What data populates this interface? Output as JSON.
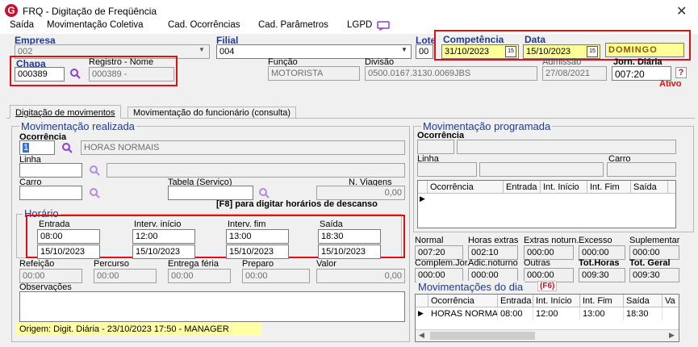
{
  "window": {
    "title": "FRQ - Digitação de Freqüência",
    "app_letter": "G"
  },
  "menu": [
    "Saída",
    "Movimentação Coletiva",
    "Cad. Ocorrências",
    "Cad. Parâmetros",
    "LGPD"
  ],
  "header": {
    "empresa_label": "Empresa",
    "empresa_value": "002",
    "filial_label": "Filial",
    "filial_value": "004",
    "lote_label": "Lote",
    "lote_value": "00",
    "competencia_label": "Competência",
    "competencia_value": "31/10/2023",
    "data_label": "Data",
    "data_value": "15/10/2023",
    "weekday": "DOMINGO",
    "chapa_label": "Chapa",
    "chapa_value": "000389",
    "registro_label": "Registro - Nome",
    "registro_value": "000389 -",
    "funcao_label": "Função",
    "funcao_value": "MOTORISTA",
    "divisao_label": "Divisão",
    "divisao_value": "0500.0167.3130.0069JBS",
    "admissao_label": "Admissão",
    "admissao_value": "27/08/2021",
    "jornada_label": "Jorn. Diária",
    "jornada_value": "007:20",
    "help": "?",
    "status": "Ativo"
  },
  "tabs": [
    "Digitação de movimentos",
    "Movimentação do funcionário (consulta)"
  ],
  "realizada": {
    "title": "Movimentação realizada",
    "ocorrencia_label": "Ocorrência",
    "ocorrencia_code": "1",
    "ocorrencia_name": "HORAS NORMAIS",
    "linha_label": "Linha",
    "carro_label": "Carro",
    "tabela_label": "Tabela (Serviço)",
    "viagens_label": "N. Viagens",
    "viagens_value": "0,00",
    "f8_hint": "[F8] para digitar horários de descanso",
    "horario": {
      "title": "Horário",
      "entrada_label": "Entrada",
      "entrada_time": "08:00",
      "entrada_date": "15/10/2023",
      "interv_inicio_label": "Interv. início",
      "interv_inicio_time": "12:00",
      "interv_inicio_date": "15/10/2023",
      "interv_fim_label": "Interv. fim",
      "interv_fim_time": "13:00",
      "interv_fim_date": "15/10/2023",
      "saida_label": "Saída",
      "saida_time": "18:30",
      "saida_date": "15/10/2023"
    },
    "refeicao_label": "Refeição",
    "refeicao_value": "00:00",
    "percurso_label": "Percurso",
    "percurso_value": "00:00",
    "entrega_label": "Entrega féria",
    "entrega_value": "00:00",
    "preparo_label": "Preparo",
    "preparo_value": "00:00",
    "valor_label": "Valor",
    "valor_value": "0,00",
    "observacoes_label": "Observações",
    "origem": "Origem: Digit. Diária - 23/10/2023 17:50 - MANAGER"
  },
  "programada": {
    "title": "Movimentação programada",
    "ocorrencia_label": "Ocorrência",
    "linha_label": "Linha",
    "carro_label": "Carro",
    "grid_headers": [
      "Ocorrência",
      "Entrada",
      "Int. Início",
      "Int. Fim",
      "Saída"
    ]
  },
  "totals": {
    "row1": [
      {
        "label": "Normal",
        "value": "007:20"
      },
      {
        "label": "Horas extras",
        "value": "002:10"
      },
      {
        "label": "Extras noturn.",
        "value": "000:00"
      },
      {
        "label": "Excesso",
        "value": "000:00"
      },
      {
        "label": "Suplementar",
        "value": "000:00"
      }
    ],
    "row2": [
      {
        "label": "Complem.Jor.",
        "value": "000:00"
      },
      {
        "label": "Adic.noturno",
        "value": "000:00"
      },
      {
        "label": "Outras",
        "value": "000:00"
      },
      {
        "label": "Tot.Horas",
        "value": "009:30"
      },
      {
        "label": "Tot. Geral",
        "value": "009:30"
      }
    ]
  },
  "dia": {
    "title": "Movimentações do dia",
    "shortcut": "(F6)",
    "headers": [
      "Ocorrência",
      "Entrada",
      "Int. Início",
      "Int. Fim",
      "Saída",
      "Va"
    ],
    "rows": [
      {
        "ocorrencia": "HORAS NORMAIS",
        "entrada": "08:00",
        "int_inicio": "12:00",
        "int_fim": "13:00",
        "saida": "18:30",
        "va": ""
      }
    ]
  },
  "colors": {
    "accent_blue": "#1f3a93",
    "highlight_red": "#e01010",
    "yellow": "#ffff99",
    "status_red": "#e01010",
    "search_purple": "#8a3fd1"
  }
}
